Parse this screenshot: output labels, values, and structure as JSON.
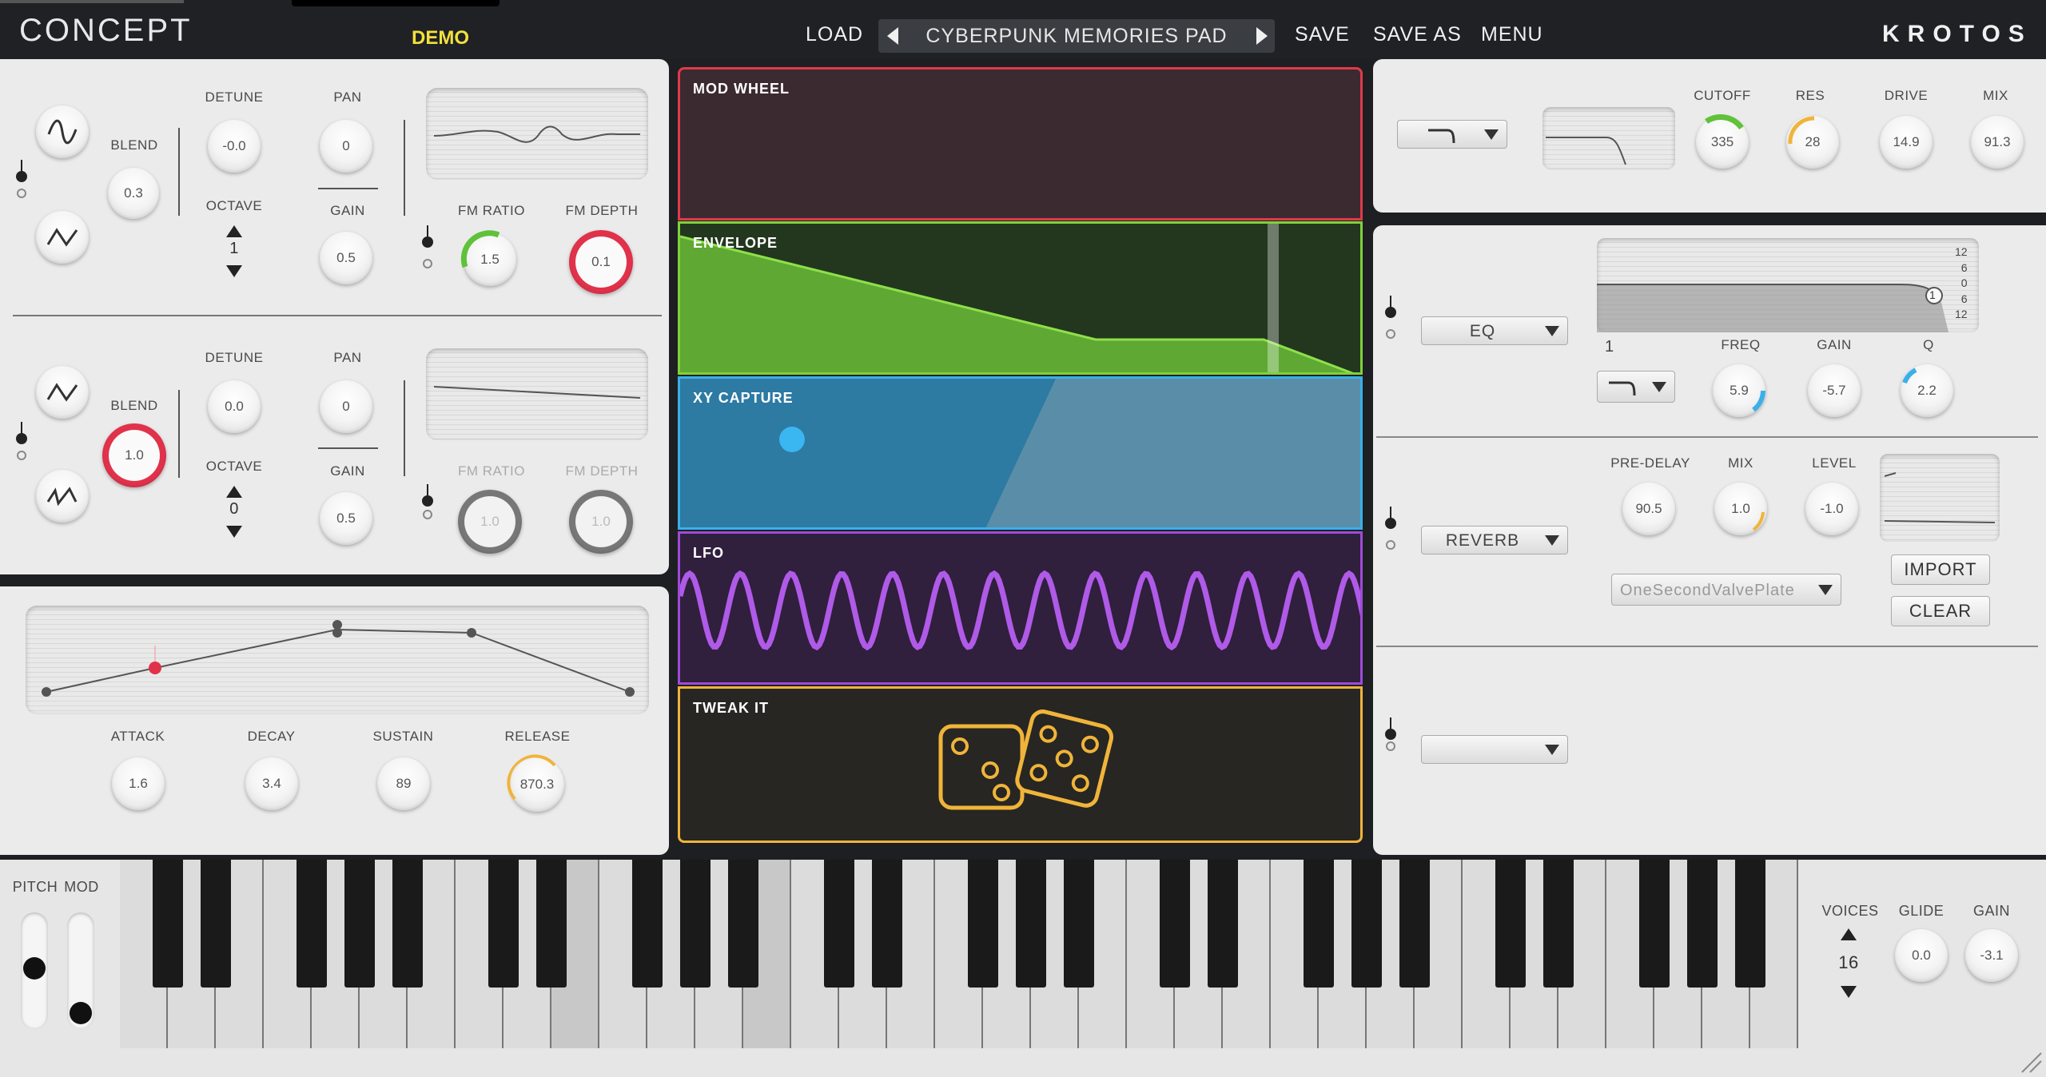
{
  "app": {
    "brand": "CONCEPT",
    "badge": "DEMO",
    "vendor": "KROTOS"
  },
  "toolbar": {
    "load": "LOAD",
    "preset": "CYBERPUNK MEMORIES PAD",
    "save": "SAVE",
    "save_as": "SAVE AS",
    "menu": "MENU"
  },
  "osc1": {
    "blend_label": "BLEND",
    "blend": "0.3",
    "detune_label": "DETUNE",
    "detune": "-0.0",
    "octave_label": "OCTAVE",
    "octave": "1",
    "pan_label": "PAN",
    "pan": "0",
    "gain_label": "GAIN",
    "gain": "0.5",
    "fm_ratio_label": "FM RATIO",
    "fm_ratio": "1.5",
    "fm_depth_label": "FM DEPTH",
    "fm_depth": "0.1"
  },
  "osc2": {
    "blend_label": "BLEND",
    "blend": "1.0",
    "detune_label": "DETUNE",
    "detune": "0.0",
    "octave_label": "OCTAVE",
    "octave": "0",
    "pan_label": "PAN",
    "pan": "0",
    "gain_label": "GAIN",
    "gain": "0.5",
    "fm_ratio_label": "FM RATIO",
    "fm_ratio": "1.0",
    "fm_depth_label": "FM DEPTH",
    "fm_depth": "1.0"
  },
  "envelope": {
    "attack_label": "ATTACK",
    "attack": "1.6",
    "decay_label": "DECAY",
    "decay": "3.4",
    "sustain_label": "SUSTAIN",
    "sustain": "89",
    "release_label": "RELEASE",
    "release": "870.3"
  },
  "modulators": {
    "mod_wheel": "MOD WHEEL",
    "envelope": "ENVELOPE",
    "xy_capture": "XY CAPTURE",
    "lfo": "LFO",
    "tweak_it": "TWEAK IT"
  },
  "filter": {
    "cutoff_label": "CUTOFF",
    "cutoff": "335",
    "res_label": "RES",
    "res": "28",
    "drive_label": "DRIVE",
    "drive": "14.9",
    "mix_label": "MIX",
    "mix": "91.3"
  },
  "eq": {
    "type": "EQ",
    "band": "1",
    "freq_label": "FREQ",
    "freq": "5.9",
    "gain_label": "GAIN",
    "gain": "-5.7",
    "q_label": "Q",
    "q": "2.2",
    "scale": [
      "12",
      "6",
      "0",
      "6",
      "12"
    ],
    "node": "1"
  },
  "reverb": {
    "type": "REVERB",
    "pre_delay_label": "PRE-DELAY",
    "pre_delay": "90.5",
    "mix_label": "MIX",
    "mix": "1.0",
    "level_label": "LEVEL",
    "level": "-1.0",
    "impulse": "OneSecondValvePlate",
    "import": "IMPORT",
    "clear": "CLEAR"
  },
  "performance": {
    "pitch_label": "PITCH",
    "mod_label": "MOD",
    "voices_label": "VOICES",
    "voices": "16",
    "glide_label": "GLIDE",
    "glide": "0.0",
    "gain_label": "GAIN",
    "gain": "-3.1"
  },
  "colors": {
    "mod_wheel": "#e03a4a",
    "envelope": "#7ed23a",
    "xy": "#3ab0e8",
    "lfo": "#a04ad8",
    "tweak": "#f0b43a"
  }
}
